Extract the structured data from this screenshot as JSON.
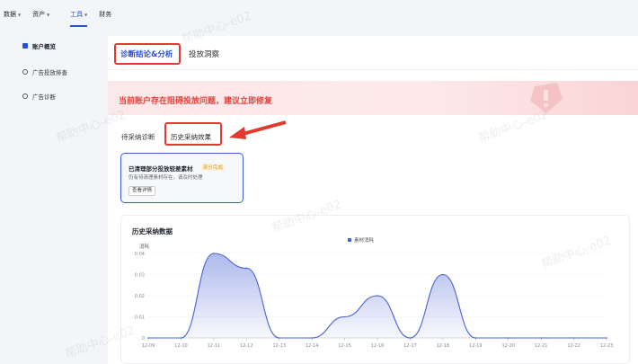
{
  "topnav": {
    "items": [
      {
        "label": "数据"
      },
      {
        "label": "资产"
      },
      {
        "label": "工具"
      },
      {
        "label": "财务"
      }
    ]
  },
  "sidebar": {
    "items": [
      {
        "label": "账户概览"
      },
      {
        "label": "广告投放排查"
      },
      {
        "label": "广告诊断"
      }
    ]
  },
  "tabs": [
    {
      "label": "诊断结论&分析"
    },
    {
      "label": "投放洞察"
    }
  ],
  "banner": {
    "text": "当前账户存在阻碍投放问题，建议立即修复"
  },
  "subtabs": [
    {
      "label": "待采纳诊断"
    },
    {
      "label": "历史采纳效果"
    }
  ],
  "card": {
    "title": "已清理部分投放较差素材",
    "badge": "部分完成",
    "desc": "仍有待清理素材存在，请及时处理",
    "button": "查看详情"
  },
  "watermark": "帮助中心-e02",
  "colors": {
    "accent": "#2a4fd6",
    "alert": "#e23a2f",
    "line": "#4a63d6"
  },
  "chart_data": {
    "type": "area",
    "title": "历史采纳数据",
    "ylabel": "消耗",
    "legend": "素材消耗",
    "legend_position": "top-center",
    "ylim": [
      0,
      0.04
    ],
    "yticks": [
      "0",
      "0.01",
      "0.02",
      "0.03",
      "0.04"
    ],
    "categories": [
      "12-09",
      "12-10",
      "12-11",
      "12-12",
      "12-13",
      "12-14",
      "12-15",
      "12-16",
      "12-17",
      "12-18",
      "12-19",
      "12-20",
      "12-21",
      "12-22",
      "12-23"
    ],
    "values": [
      0,
      0,
      0.04,
      0.033,
      0,
      0,
      0.01,
      0.02,
      0,
      0.03,
      0,
      0,
      0,
      0,
      0
    ]
  }
}
